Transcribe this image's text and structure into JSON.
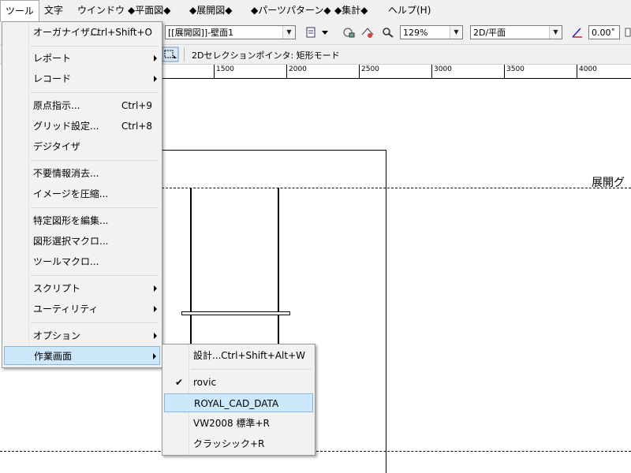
{
  "menubar": {
    "items": [
      {
        "label": "ツール"
      },
      {
        "label": "文字"
      },
      {
        "label": "ウインドウ"
      },
      {
        "label": "◆平面図◆"
      },
      {
        "label": "◆展開図◆"
      },
      {
        "label": "◆パーツパターン◆"
      },
      {
        "label": "◆集計◆"
      },
      {
        "label": "ヘルプ(H)"
      }
    ]
  },
  "toolbar": {
    "layer_combo": "[[展開図]]-壁面1",
    "zoom_combo": "129%",
    "view_combo": "2D/平面",
    "angle_value": "0.00˚",
    "mode_text": "2Dセレクションポインタ: 矩形モード"
  },
  "ruler": {
    "labels": [
      "1500",
      "2000",
      "2500",
      "3000",
      "3500",
      "4000"
    ]
  },
  "canvas": {
    "label": "展開グ"
  },
  "tools_menu": {
    "items": [
      {
        "label": "オーガナイザ...",
        "shortcut": "Ctrl+Shift+O"
      },
      {
        "label": "レポート"
      },
      {
        "label": "レコード"
      },
      {
        "label": "原点指示...",
        "shortcut": "Ctrl+9"
      },
      {
        "label": "グリッド設定...",
        "shortcut": "Ctrl+8"
      },
      {
        "label": "デジタイザ"
      },
      {
        "label": "不要情報消去..."
      },
      {
        "label": "イメージを圧縮..."
      },
      {
        "label": "特定図形を編集..."
      },
      {
        "label": "図形選択マクロ..."
      },
      {
        "label": "ツールマクロ..."
      },
      {
        "label": "スクリプト"
      },
      {
        "label": "ユーティリティ"
      },
      {
        "label": "オプション"
      },
      {
        "label": "作業画面"
      }
    ]
  },
  "workspace_menu": {
    "items": [
      {
        "label": "設計...",
        "shortcut": "Ctrl+Shift+Alt+W"
      },
      {
        "label": "rovic",
        "checked": true
      },
      {
        "label": "ROYAL_CAD_DATA"
      },
      {
        "label": "VW2008 標準+R"
      },
      {
        "label": "クラッシック+R"
      }
    ]
  }
}
